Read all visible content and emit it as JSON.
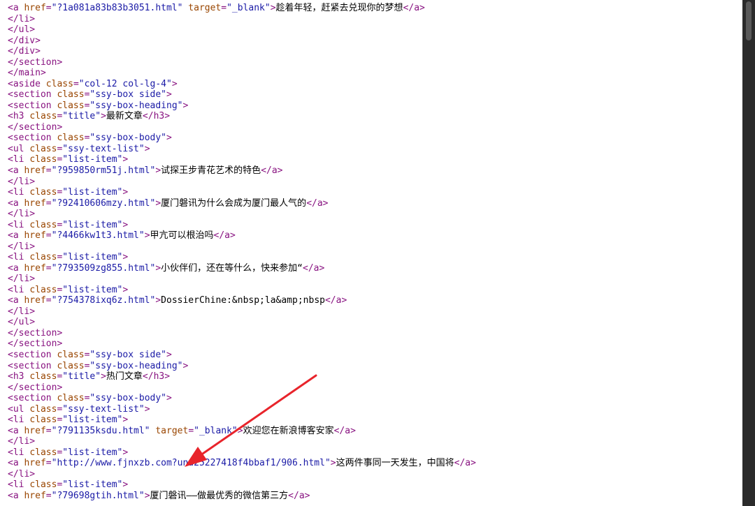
{
  "colors": {
    "background": "#ffffff",
    "frame": "#2b2b2b",
    "tag": "#881280",
    "attribute": "#994500",
    "value": "#1a1aa6",
    "text": "#000000",
    "annotation_arrow": "#e8242b"
  },
  "annotation": {
    "icon": "red-arrow-icon"
  },
  "source_lines": [
    [
      {
        "c": "tag",
        "t": "<a "
      },
      {
        "c": "attr",
        "t": "href"
      },
      {
        "c": "tag",
        "t": "="
      },
      {
        "c": "val",
        "t": "\"?1a081a83b83b3051.html\""
      },
      {
        "c": "tag",
        "t": " "
      },
      {
        "c": "attr",
        "t": "target"
      },
      {
        "c": "tag",
        "t": "="
      },
      {
        "c": "val",
        "t": "\"_blank\""
      },
      {
        "c": "tag",
        "t": ">"
      },
      {
        "c": "txt",
        "t": "趁着年轻，赶紧去兑现你的梦想"
      },
      {
        "c": "tag",
        "t": "</a>"
      }
    ],
    [
      {
        "c": "tag",
        "t": "</li>"
      }
    ],
    [
      {
        "c": "tag",
        "t": "</ul>"
      }
    ],
    [
      {
        "c": "tag",
        "t": "</div>"
      }
    ],
    [
      {
        "c": "tag",
        "t": "</div>"
      }
    ],
    [
      {
        "c": "tag",
        "t": "</section>"
      }
    ],
    [
      {
        "c": "tag",
        "t": "</main>"
      }
    ],
    [
      {
        "c": "tag",
        "t": "<aside "
      },
      {
        "c": "attr",
        "t": "class"
      },
      {
        "c": "tag",
        "t": "="
      },
      {
        "c": "val",
        "t": "\"col-12 col-lg-4\""
      },
      {
        "c": "tag",
        "t": ">"
      }
    ],
    [
      {
        "c": "tag",
        "t": "<section "
      },
      {
        "c": "attr",
        "t": "class"
      },
      {
        "c": "tag",
        "t": "="
      },
      {
        "c": "val",
        "t": "\"ssy-box side\""
      },
      {
        "c": "tag",
        "t": ">"
      }
    ],
    [
      {
        "c": "tag",
        "t": "<section "
      },
      {
        "c": "attr",
        "t": "class"
      },
      {
        "c": "tag",
        "t": "="
      },
      {
        "c": "val",
        "t": "\"ssy-box-heading\""
      },
      {
        "c": "tag",
        "t": ">"
      }
    ],
    [
      {
        "c": "tag",
        "t": "<h3 "
      },
      {
        "c": "attr",
        "t": "class"
      },
      {
        "c": "tag",
        "t": "="
      },
      {
        "c": "val",
        "t": "\"title\""
      },
      {
        "c": "tag",
        "t": ">"
      },
      {
        "c": "txt",
        "t": "最新文章"
      },
      {
        "c": "tag",
        "t": "</h3>"
      }
    ],
    [
      {
        "c": "tag",
        "t": "</section>"
      }
    ],
    [
      {
        "c": "tag",
        "t": "<section "
      },
      {
        "c": "attr",
        "t": "class"
      },
      {
        "c": "tag",
        "t": "="
      },
      {
        "c": "val",
        "t": "\"ssy-box-body\""
      },
      {
        "c": "tag",
        "t": ">"
      }
    ],
    [
      {
        "c": "tag",
        "t": "<ul "
      },
      {
        "c": "attr",
        "t": "class"
      },
      {
        "c": "tag",
        "t": "="
      },
      {
        "c": "val",
        "t": "\"ssy-text-list\""
      },
      {
        "c": "tag",
        "t": ">"
      }
    ],
    [
      {
        "c": "tag",
        "t": "<li "
      },
      {
        "c": "attr",
        "t": "class"
      },
      {
        "c": "tag",
        "t": "="
      },
      {
        "c": "val",
        "t": "\"list-item\""
      },
      {
        "c": "tag",
        "t": ">"
      }
    ],
    [
      {
        "c": "tag",
        "t": "<a "
      },
      {
        "c": "attr",
        "t": "href"
      },
      {
        "c": "tag",
        "t": "="
      },
      {
        "c": "val",
        "t": "\"?959850rm51j.html\""
      },
      {
        "c": "tag",
        "t": ">"
      },
      {
        "c": "txt",
        "t": "试探王步青花艺术的特色"
      },
      {
        "c": "tag",
        "t": "</a>"
      }
    ],
    [
      {
        "c": "tag",
        "t": "</li>"
      }
    ],
    [
      {
        "c": "tag",
        "t": "<li "
      },
      {
        "c": "attr",
        "t": "class"
      },
      {
        "c": "tag",
        "t": "="
      },
      {
        "c": "val",
        "t": "\"list-item\""
      },
      {
        "c": "tag",
        "t": ">"
      }
    ],
    [
      {
        "c": "tag",
        "t": "<a "
      },
      {
        "c": "attr",
        "t": "href"
      },
      {
        "c": "tag",
        "t": "="
      },
      {
        "c": "val",
        "t": "\"?92410606mzy.html\""
      },
      {
        "c": "tag",
        "t": ">"
      },
      {
        "c": "txt",
        "t": "厦门磐讯为什么会成为厦门最人气的"
      },
      {
        "c": "tag",
        "t": "</a>"
      }
    ],
    [
      {
        "c": "tag",
        "t": "</li>"
      }
    ],
    [
      {
        "c": "tag",
        "t": "<li "
      },
      {
        "c": "attr",
        "t": "class"
      },
      {
        "c": "tag",
        "t": "="
      },
      {
        "c": "val",
        "t": "\"list-item\""
      },
      {
        "c": "tag",
        "t": ">"
      }
    ],
    [
      {
        "c": "tag",
        "t": "<a "
      },
      {
        "c": "attr",
        "t": "href"
      },
      {
        "c": "tag",
        "t": "="
      },
      {
        "c": "val",
        "t": "\"?4466kw1t3.html\""
      },
      {
        "c": "tag",
        "t": ">"
      },
      {
        "c": "txt",
        "t": "甲亢可以根治吗"
      },
      {
        "c": "tag",
        "t": "</a>"
      }
    ],
    [
      {
        "c": "tag",
        "t": "</li>"
      }
    ],
    [
      {
        "c": "tag",
        "t": "<li "
      },
      {
        "c": "attr",
        "t": "class"
      },
      {
        "c": "tag",
        "t": "="
      },
      {
        "c": "val",
        "t": "\"list-item\""
      },
      {
        "c": "tag",
        "t": ">"
      }
    ],
    [
      {
        "c": "tag",
        "t": "<a "
      },
      {
        "c": "attr",
        "t": "href"
      },
      {
        "c": "tag",
        "t": "="
      },
      {
        "c": "val",
        "t": "\"?793509zg855.html\""
      },
      {
        "c": "tag",
        "t": ">"
      },
      {
        "c": "txt",
        "t": "小伙伴们，还在等什么，快来参加“"
      },
      {
        "c": "tag",
        "t": "</a>"
      }
    ],
    [
      {
        "c": "tag",
        "t": "</li>"
      }
    ],
    [
      {
        "c": "tag",
        "t": "<li "
      },
      {
        "c": "attr",
        "t": "class"
      },
      {
        "c": "tag",
        "t": "="
      },
      {
        "c": "val",
        "t": "\"list-item\""
      },
      {
        "c": "tag",
        "t": ">"
      }
    ],
    [
      {
        "c": "tag",
        "t": "<a "
      },
      {
        "c": "attr",
        "t": "href"
      },
      {
        "c": "tag",
        "t": "="
      },
      {
        "c": "val",
        "t": "\"?754378ixq6z.html\""
      },
      {
        "c": "tag",
        "t": ">"
      },
      {
        "c": "txt",
        "t": "DossierChine:&nbsp;la&amp;nbsp"
      },
      {
        "c": "tag",
        "t": "</a>"
      }
    ],
    [
      {
        "c": "tag",
        "t": "</li>"
      }
    ],
    [
      {
        "c": "tag",
        "t": "</ul>"
      }
    ],
    [
      {
        "c": "tag",
        "t": "</section>"
      }
    ],
    [
      {
        "c": "tag",
        "t": "</section>"
      }
    ],
    [
      {
        "c": "tag",
        "t": "<section "
      },
      {
        "c": "attr",
        "t": "class"
      },
      {
        "c": "tag",
        "t": "="
      },
      {
        "c": "val",
        "t": "\"ssy-box side\""
      },
      {
        "c": "tag",
        "t": ">"
      }
    ],
    [
      {
        "c": "tag",
        "t": "<section "
      },
      {
        "c": "attr",
        "t": "class"
      },
      {
        "c": "tag",
        "t": "="
      },
      {
        "c": "val",
        "t": "\"ssy-box-heading\""
      },
      {
        "c": "tag",
        "t": ">"
      }
    ],
    [
      {
        "c": "tag",
        "t": "<h3 "
      },
      {
        "c": "attr",
        "t": "class"
      },
      {
        "c": "tag",
        "t": "="
      },
      {
        "c": "val",
        "t": "\"title\""
      },
      {
        "c": "tag",
        "t": ">"
      },
      {
        "c": "txt",
        "t": "热门文章"
      },
      {
        "c": "tag",
        "t": "</h3>"
      }
    ],
    [
      {
        "c": "tag",
        "t": "</section>"
      }
    ],
    [
      {
        "c": "tag",
        "t": "<section "
      },
      {
        "c": "attr",
        "t": "class"
      },
      {
        "c": "tag",
        "t": "="
      },
      {
        "c": "val",
        "t": "\"ssy-box-body\""
      },
      {
        "c": "tag",
        "t": ">"
      }
    ],
    [
      {
        "c": "tag",
        "t": "<ul "
      },
      {
        "c": "attr",
        "t": "class"
      },
      {
        "c": "tag",
        "t": "="
      },
      {
        "c": "val",
        "t": "\"ssy-text-list\""
      },
      {
        "c": "tag",
        "t": ">"
      }
    ],
    [
      {
        "c": "tag",
        "t": "<li "
      },
      {
        "c": "attr",
        "t": "class"
      },
      {
        "c": "tag",
        "t": "="
      },
      {
        "c": "val",
        "t": "\"list-item\""
      },
      {
        "c": "tag",
        "t": ">"
      }
    ],
    [
      {
        "c": "tag",
        "t": "<a "
      },
      {
        "c": "attr",
        "t": "href"
      },
      {
        "c": "tag",
        "t": "="
      },
      {
        "c": "val",
        "t": "\"?791135ksdu.html\""
      },
      {
        "c": "tag",
        "t": " "
      },
      {
        "c": "attr",
        "t": "target"
      },
      {
        "c": "tag",
        "t": "="
      },
      {
        "c": "val",
        "t": "\"_blank\""
      },
      {
        "c": "tag",
        "t": ">"
      },
      {
        "c": "txt",
        "t": "欢迎您在新浪博客安家"
      },
      {
        "c": "tag",
        "t": "</a>"
      }
    ],
    [
      {
        "c": "tag",
        "t": "</li>"
      }
    ],
    [
      {
        "c": "tag",
        "t": "<li "
      },
      {
        "c": "attr",
        "t": "class"
      },
      {
        "c": "tag",
        "t": "="
      },
      {
        "c": "val",
        "t": "\"list-item\""
      },
      {
        "c": "tag",
        "t": ">"
      }
    ],
    [
      {
        "c": "tag",
        "t": "<a "
      },
      {
        "c": "attr",
        "t": "href"
      },
      {
        "c": "tag",
        "t": "="
      },
      {
        "c": "val",
        "t": "\"http://www.fjnxzb.com?una25227418f4bbaf1/906.html\""
      },
      {
        "c": "tag",
        "t": ">"
      },
      {
        "c": "txt",
        "t": "这两件事同一天发生，中国将"
      },
      {
        "c": "tag",
        "t": "</a>"
      }
    ],
    [
      {
        "c": "tag",
        "t": "</li>"
      }
    ],
    [
      {
        "c": "tag",
        "t": "<li "
      },
      {
        "c": "attr",
        "t": "class"
      },
      {
        "c": "tag",
        "t": "="
      },
      {
        "c": "val",
        "t": "\"list-item\""
      },
      {
        "c": "tag",
        "t": ">"
      }
    ],
    [
      {
        "c": "tag",
        "t": "<a "
      },
      {
        "c": "attr",
        "t": "href"
      },
      {
        "c": "tag",
        "t": "="
      },
      {
        "c": "val",
        "t": "\"?79698gtih.html\""
      },
      {
        "c": "tag",
        "t": ">"
      },
      {
        "c": "txt",
        "t": "厦门磐讯——做最优秀的微信第三方"
      },
      {
        "c": "tag",
        "t": "</a>"
      }
    ]
  ]
}
